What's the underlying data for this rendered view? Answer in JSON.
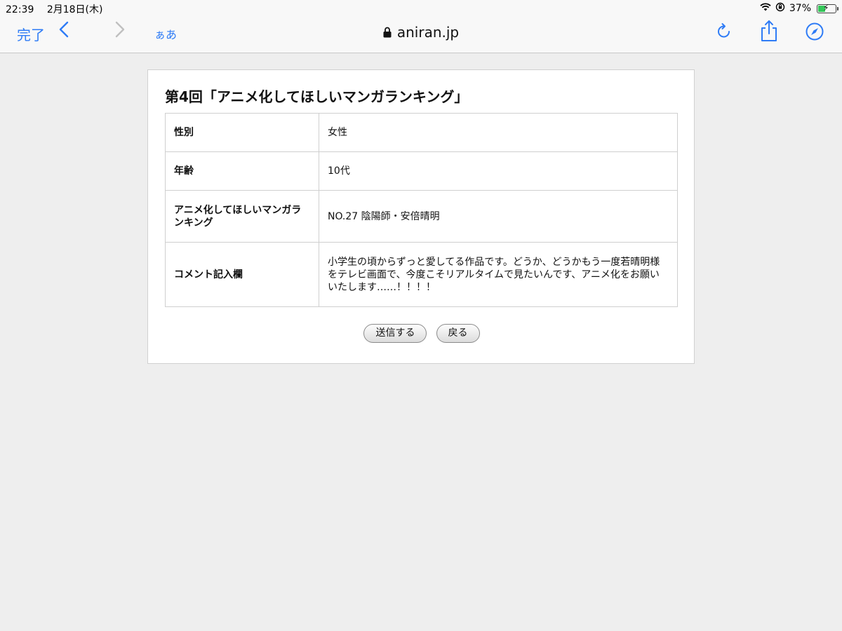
{
  "status": {
    "time": "22:39",
    "date": "2月18日(木)",
    "battery_percent_text": "37%",
    "battery_level": 0.37
  },
  "browser": {
    "done_label": "完了",
    "reader_label": "ぁあ",
    "address": "aniran.jp"
  },
  "page": {
    "title": "第4回「アニメ化してほしいマンガランキング」",
    "rows": [
      {
        "label": "性別",
        "value": "女性"
      },
      {
        "label": "年齢",
        "value": "10代"
      },
      {
        "label": "アニメ化してほしいマンガランキング",
        "value": "NO.27 陰陽師・安倍晴明"
      },
      {
        "label": "コメント記入欄",
        "value": "小学生の頃からずっと愛してる作品です。どうか、どうかもう一度若晴明様をテレビ画面で、今度こそリアルタイムで見たいんです、アニメ化をお願いいたします……！！！！"
      }
    ],
    "submit_label": "送信する",
    "back_label": "戻る"
  },
  "colors": {
    "accent": "#2f7cf6",
    "page_background": "#eeeeee",
    "battery_green": "#34c759"
  }
}
